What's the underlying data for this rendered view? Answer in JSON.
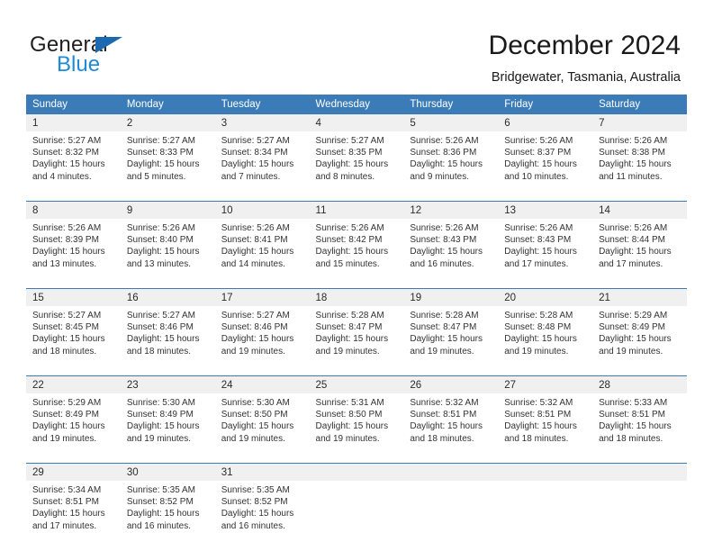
{
  "brand": {
    "name_part1": "General",
    "name_part2": "Blue",
    "triangle_color": "#1b69b0",
    "blue_text_color": "#1f8ad6"
  },
  "header": {
    "title": "December 2024",
    "subtitle": "Bridgewater, Tasmania, Australia"
  },
  "theme": {
    "header_bg": "#3b7cb8",
    "daynum_bg": "#f0f0f0",
    "row_divider": "#3b7cb8"
  },
  "calendar": {
    "weekday_headers": [
      "Sunday",
      "Monday",
      "Tuesday",
      "Wednesday",
      "Thursday",
      "Friday",
      "Saturday"
    ],
    "weeks": [
      [
        {
          "day": "1",
          "sunrise": "Sunrise: 5:27 AM",
          "sunset": "Sunset: 8:32 PM",
          "daylight_l1": "Daylight: 15 hours",
          "daylight_l2": "and 4 minutes."
        },
        {
          "day": "2",
          "sunrise": "Sunrise: 5:27 AM",
          "sunset": "Sunset: 8:33 PM",
          "daylight_l1": "Daylight: 15 hours",
          "daylight_l2": "and 5 minutes."
        },
        {
          "day": "3",
          "sunrise": "Sunrise: 5:27 AM",
          "sunset": "Sunset: 8:34 PM",
          "daylight_l1": "Daylight: 15 hours",
          "daylight_l2": "and 7 minutes."
        },
        {
          "day": "4",
          "sunrise": "Sunrise: 5:27 AM",
          "sunset": "Sunset: 8:35 PM",
          "daylight_l1": "Daylight: 15 hours",
          "daylight_l2": "and 8 minutes."
        },
        {
          "day": "5",
          "sunrise": "Sunrise: 5:26 AM",
          "sunset": "Sunset: 8:36 PM",
          "daylight_l1": "Daylight: 15 hours",
          "daylight_l2": "and 9 minutes."
        },
        {
          "day": "6",
          "sunrise": "Sunrise: 5:26 AM",
          "sunset": "Sunset: 8:37 PM",
          "daylight_l1": "Daylight: 15 hours",
          "daylight_l2": "and 10 minutes."
        },
        {
          "day": "7",
          "sunrise": "Sunrise: 5:26 AM",
          "sunset": "Sunset: 8:38 PM",
          "daylight_l1": "Daylight: 15 hours",
          "daylight_l2": "and 11 minutes."
        }
      ],
      [
        {
          "day": "8",
          "sunrise": "Sunrise: 5:26 AM",
          "sunset": "Sunset: 8:39 PM",
          "daylight_l1": "Daylight: 15 hours",
          "daylight_l2": "and 13 minutes."
        },
        {
          "day": "9",
          "sunrise": "Sunrise: 5:26 AM",
          "sunset": "Sunset: 8:40 PM",
          "daylight_l1": "Daylight: 15 hours",
          "daylight_l2": "and 13 minutes."
        },
        {
          "day": "10",
          "sunrise": "Sunrise: 5:26 AM",
          "sunset": "Sunset: 8:41 PM",
          "daylight_l1": "Daylight: 15 hours",
          "daylight_l2": "and 14 minutes."
        },
        {
          "day": "11",
          "sunrise": "Sunrise: 5:26 AM",
          "sunset": "Sunset: 8:42 PM",
          "daylight_l1": "Daylight: 15 hours",
          "daylight_l2": "and 15 minutes."
        },
        {
          "day": "12",
          "sunrise": "Sunrise: 5:26 AM",
          "sunset": "Sunset: 8:43 PM",
          "daylight_l1": "Daylight: 15 hours",
          "daylight_l2": "and 16 minutes."
        },
        {
          "day": "13",
          "sunrise": "Sunrise: 5:26 AM",
          "sunset": "Sunset: 8:43 PM",
          "daylight_l1": "Daylight: 15 hours",
          "daylight_l2": "and 17 minutes."
        },
        {
          "day": "14",
          "sunrise": "Sunrise: 5:26 AM",
          "sunset": "Sunset: 8:44 PM",
          "daylight_l1": "Daylight: 15 hours",
          "daylight_l2": "and 17 minutes."
        }
      ],
      [
        {
          "day": "15",
          "sunrise": "Sunrise: 5:27 AM",
          "sunset": "Sunset: 8:45 PM",
          "daylight_l1": "Daylight: 15 hours",
          "daylight_l2": "and 18 minutes."
        },
        {
          "day": "16",
          "sunrise": "Sunrise: 5:27 AM",
          "sunset": "Sunset: 8:46 PM",
          "daylight_l1": "Daylight: 15 hours",
          "daylight_l2": "and 18 minutes."
        },
        {
          "day": "17",
          "sunrise": "Sunrise: 5:27 AM",
          "sunset": "Sunset: 8:46 PM",
          "daylight_l1": "Daylight: 15 hours",
          "daylight_l2": "and 19 minutes."
        },
        {
          "day": "18",
          "sunrise": "Sunrise: 5:28 AM",
          "sunset": "Sunset: 8:47 PM",
          "daylight_l1": "Daylight: 15 hours",
          "daylight_l2": "and 19 minutes."
        },
        {
          "day": "19",
          "sunrise": "Sunrise: 5:28 AM",
          "sunset": "Sunset: 8:47 PM",
          "daylight_l1": "Daylight: 15 hours",
          "daylight_l2": "and 19 minutes."
        },
        {
          "day": "20",
          "sunrise": "Sunrise: 5:28 AM",
          "sunset": "Sunset: 8:48 PM",
          "daylight_l1": "Daylight: 15 hours",
          "daylight_l2": "and 19 minutes."
        },
        {
          "day": "21",
          "sunrise": "Sunrise: 5:29 AM",
          "sunset": "Sunset: 8:49 PM",
          "daylight_l1": "Daylight: 15 hours",
          "daylight_l2": "and 19 minutes."
        }
      ],
      [
        {
          "day": "22",
          "sunrise": "Sunrise: 5:29 AM",
          "sunset": "Sunset: 8:49 PM",
          "daylight_l1": "Daylight: 15 hours",
          "daylight_l2": "and 19 minutes."
        },
        {
          "day": "23",
          "sunrise": "Sunrise: 5:30 AM",
          "sunset": "Sunset: 8:49 PM",
          "daylight_l1": "Daylight: 15 hours",
          "daylight_l2": "and 19 minutes."
        },
        {
          "day": "24",
          "sunrise": "Sunrise: 5:30 AM",
          "sunset": "Sunset: 8:50 PM",
          "daylight_l1": "Daylight: 15 hours",
          "daylight_l2": "and 19 minutes."
        },
        {
          "day": "25",
          "sunrise": "Sunrise: 5:31 AM",
          "sunset": "Sunset: 8:50 PM",
          "daylight_l1": "Daylight: 15 hours",
          "daylight_l2": "and 19 minutes."
        },
        {
          "day": "26",
          "sunrise": "Sunrise: 5:32 AM",
          "sunset": "Sunset: 8:51 PM",
          "daylight_l1": "Daylight: 15 hours",
          "daylight_l2": "and 18 minutes."
        },
        {
          "day": "27",
          "sunrise": "Sunrise: 5:32 AM",
          "sunset": "Sunset: 8:51 PM",
          "daylight_l1": "Daylight: 15 hours",
          "daylight_l2": "and 18 minutes."
        },
        {
          "day": "28",
          "sunrise": "Sunrise: 5:33 AM",
          "sunset": "Sunset: 8:51 PM",
          "daylight_l1": "Daylight: 15 hours",
          "daylight_l2": "and 18 minutes."
        }
      ],
      [
        {
          "day": "29",
          "sunrise": "Sunrise: 5:34 AM",
          "sunset": "Sunset: 8:51 PM",
          "daylight_l1": "Daylight: 15 hours",
          "daylight_l2": "and 17 minutes."
        },
        {
          "day": "30",
          "sunrise": "Sunrise: 5:35 AM",
          "sunset": "Sunset: 8:52 PM",
          "daylight_l1": "Daylight: 15 hours",
          "daylight_l2": "and 16 minutes."
        },
        {
          "day": "31",
          "sunrise": "Sunrise: 5:35 AM",
          "sunset": "Sunset: 8:52 PM",
          "daylight_l1": "Daylight: 15 hours",
          "daylight_l2": "and 16 minutes."
        },
        {
          "day": "",
          "sunrise": "",
          "sunset": "",
          "daylight_l1": "",
          "daylight_l2": ""
        },
        {
          "day": "",
          "sunrise": "",
          "sunset": "",
          "daylight_l1": "",
          "daylight_l2": ""
        },
        {
          "day": "",
          "sunrise": "",
          "sunset": "",
          "daylight_l1": "",
          "daylight_l2": ""
        },
        {
          "day": "",
          "sunrise": "",
          "sunset": "",
          "daylight_l1": "",
          "daylight_l2": ""
        }
      ]
    ]
  }
}
